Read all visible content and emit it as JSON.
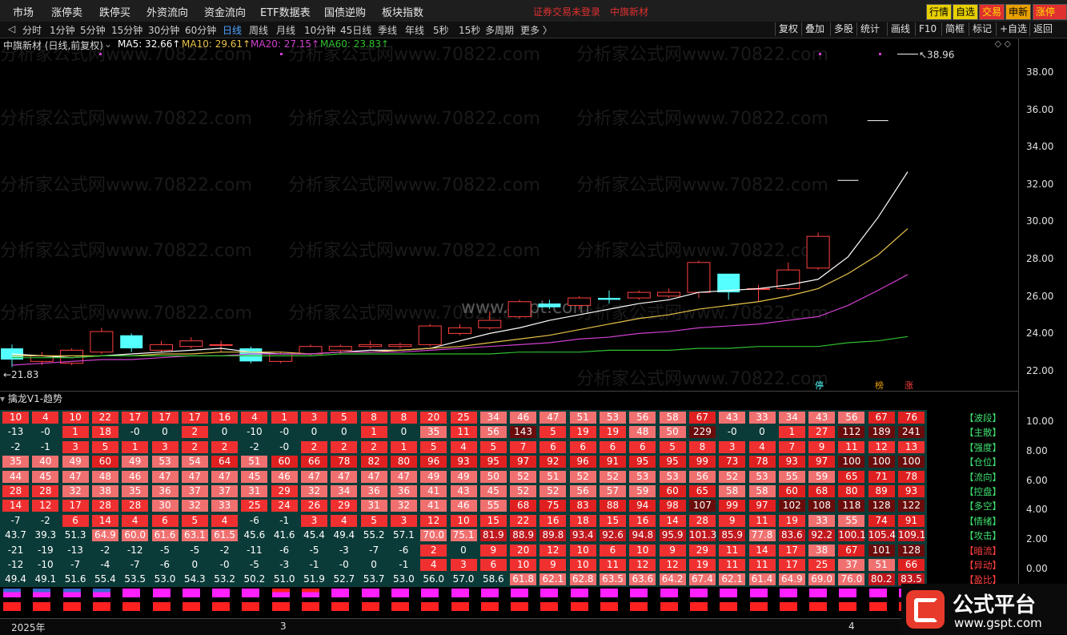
{
  "menu": [
    "市场",
    "涨停卖",
    "跌停买",
    "外资流向",
    "资金流向",
    "ETF数据表",
    "国债逆购",
    "板块指数"
  ],
  "status_text": "证券交易未登录　中旗新材",
  "right_buttons": [
    {
      "label": "行情",
      "bg": "#e8d000",
      "fg": "#000"
    },
    {
      "label": "自选",
      "bg": "#e8d000",
      "fg": "#000"
    },
    {
      "label": "交易",
      "bg": "#e03030",
      "fg": "#ffe000"
    },
    {
      "label": "申新",
      "bg": "#e8a000",
      "fg": "#000"
    },
    {
      "label": "涨停买",
      "bg": "#e03030",
      "fg": "#ffe000"
    }
  ],
  "periods": [
    "分时",
    "1分钟",
    "5分钟",
    "15分钟",
    "30分钟",
    "60分钟",
    "日线",
    "周线",
    "月线",
    "10分钟",
    "45日线",
    "季线",
    "年线",
    "5秒",
    "15秒",
    "多周期",
    "更多 〉"
  ],
  "active_period": "日线",
  "tools": [
    "复权",
    "叠加",
    "多股",
    "统计",
    "画线",
    "F10",
    "简框",
    "标记",
    "+自选",
    "返回"
  ],
  "stock_title": "中旗新材 (日线,前复权)",
  "ma": [
    {
      "label": "MA5: 32.66↑",
      "color": "#ffffff"
    },
    {
      "label": "MA10: 29.61↑",
      "color": "#e8c34a"
    },
    {
      "label": "MA20: 27.15↑",
      "color": "#d040d0"
    },
    {
      "label": "MA60: 23.83↑",
      "color": "#30c030"
    }
  ],
  "price_ticks": [
    "38.00",
    "36.00",
    "34.00",
    "32.00",
    "30.00",
    "28.00",
    "26.00",
    "24.00",
    "22.00"
  ],
  "high_label": "38.96",
  "low_label": "←21.83",
  "watermark": "分析家公式网www.70822.com",
  "center_watermark": "www.gspt.com",
  "markers": [
    "停",
    "榜",
    "涨"
  ],
  "indicator_title": "擒龙V1-趋势",
  "ind_ticks": [
    "10.00",
    "8.00",
    "6.00",
    "4.00",
    "2.00",
    "0.00"
  ],
  "rows": [
    {
      "tag": "【波段】",
      "tagRed": false,
      "v": [
        "10",
        "4",
        "10",
        "22",
        "17",
        "17",
        "17",
        "16",
        "4",
        "1",
        "3",
        "5",
        "8",
        "8",
        "20",
        "25",
        "34",
        "46",
        "47",
        "51",
        "53",
        "56",
        "58",
        "67",
        "43",
        "33",
        "34",
        "43",
        "56",
        "67",
        "76"
      ]
    },
    {
      "tag": "【主散】",
      "tagRed": false,
      "v": [
        "-13",
        "-0",
        "1",
        "18",
        "-0",
        "0",
        "2",
        "0",
        "-10",
        "-0",
        "0",
        "0",
        "1",
        "0",
        "35",
        "11",
        "56",
        "143",
        "5",
        "19",
        "19",
        "48",
        "50",
        "229",
        "-0",
        "0",
        "1",
        "27",
        "112",
        "189",
        "241"
      ]
    },
    {
      "tag": "【强度】",
      "tagRed": false,
      "v": [
        "-2",
        "-1",
        "3",
        "5",
        "1",
        "3",
        "2",
        "2",
        "-2",
        "-0",
        "2",
        "2",
        "2",
        "1",
        "5",
        "4",
        "5",
        "7",
        "6",
        "6",
        "6",
        "6",
        "5",
        "8",
        "3",
        "4",
        "7",
        "9",
        "11",
        "12",
        "13"
      ]
    },
    {
      "tag": "【仓位】",
      "tagRed": false,
      "v": [
        "35",
        "40",
        "49",
        "60",
        "49",
        "53",
        "54",
        "64",
        "51",
        "60",
        "66",
        "78",
        "82",
        "80",
        "96",
        "93",
        "95",
        "97",
        "92",
        "96",
        "91",
        "95",
        "95",
        "99",
        "73",
        "78",
        "93",
        "97",
        "100",
        "100",
        "100"
      ]
    },
    {
      "tag": "【流向】",
      "tagRed": false,
      "v": [
        "44",
        "45",
        "47",
        "48",
        "46",
        "47",
        "47",
        "47",
        "45",
        "46",
        "47",
        "47",
        "47",
        "47",
        "49",
        "49",
        "50",
        "52",
        "51",
        "52",
        "52",
        "53",
        "53",
        "56",
        "52",
        "53",
        "55",
        "59",
        "65",
        "71",
        "78"
      ]
    },
    {
      "tag": "【控盘】",
      "tagRed": false,
      "v": [
        "28",
        "28",
        "32",
        "38",
        "35",
        "36",
        "37",
        "37",
        "31",
        "29",
        "32",
        "34",
        "36",
        "36",
        "41",
        "43",
        "45",
        "52",
        "52",
        "56",
        "57",
        "59",
        "60",
        "65",
        "58",
        "58",
        "60",
        "68",
        "80",
        "89",
        "93"
      ]
    },
    {
      "tag": "【多空】",
      "tagRed": false,
      "v": [
        "14",
        "12",
        "17",
        "28",
        "28",
        "30",
        "32",
        "33",
        "25",
        "24",
        "26",
        "29",
        "31",
        "32",
        "41",
        "46",
        "55",
        "68",
        "75",
        "83",
        "88",
        "94",
        "98",
        "107",
        "99",
        "97",
        "102",
        "108",
        "118",
        "128",
        "122"
      ]
    },
    {
      "tag": "【情绪】",
      "tagRed": false,
      "v": [
        "-7",
        "-2",
        "6",
        "14",
        "4",
        "6",
        "5",
        "4",
        "-6",
        "-1",
        "3",
        "4",
        "5",
        "3",
        "12",
        "10",
        "15",
        "22",
        "16",
        "18",
        "15",
        "16",
        "14",
        "28",
        "9",
        "11",
        "19",
        "33",
        "55",
        "74",
        "91"
      ]
    },
    {
      "tag": "【攻击】",
      "tagRed": false,
      "v": [
        "43.7",
        "39.3",
        "51.3",
        "64.9",
        "60.0",
        "61.6",
        "63.1",
        "61.5",
        "45.6",
        "41.6",
        "45.4",
        "49.4",
        "55.2",
        "57.1",
        "70.0",
        "75.1",
        "81.9",
        "88.9",
        "89.8",
        "93.4",
        "92.6",
        "94.8",
        "95.9",
        "101.3",
        "85.9",
        "77.8",
        "83.6",
        "92.2",
        "100.1",
        "105.4",
        "109.1"
      ]
    },
    {
      "tag": "【暗流】",
      "tagRed": true,
      "v": [
        "-21",
        "-19",
        "-13",
        "-2",
        "-12",
        "-5",
        "-5",
        "-2",
        "-11",
        "-6",
        "-5",
        "-3",
        "-7",
        "-6",
        "2",
        "0",
        "9",
        "20",
        "12",
        "10",
        "6",
        "10",
        "9",
        "29",
        "11",
        "14",
        "17",
        "38",
        "67",
        "101",
        "128"
      ]
    },
    {
      "tag": "【异动】",
      "tagRed": true,
      "v": [
        "-12",
        "-10",
        "-7",
        "-4",
        "-7",
        "-6",
        "0",
        "-0",
        "-5",
        "-3",
        "-1",
        "-0",
        "0",
        "-1",
        "4",
        "3",
        "6",
        "10",
        "9",
        "10",
        "11",
        "12",
        "12",
        "19",
        "11",
        "11",
        "17",
        "25",
        "37",
        "51",
        "66"
      ]
    },
    {
      "tag": "【盈比】",
      "tagRed": true,
      "v": [
        "49.4",
        "49.1",
        "51.6",
        "55.4",
        "53.5",
        "53.0",
        "54.3",
        "53.2",
        "50.2",
        "51.0",
        "51.9",
        "52.7",
        "53.7",
        "53.0",
        "56.0",
        "57.0",
        "58.6",
        "61.8",
        "62.1",
        "62.8",
        "63.5",
        "63.6",
        "64.2",
        "67.4",
        "62.1",
        "61.4",
        "64.9",
        "69.0",
        "76.0",
        "80.2",
        "83.5"
      ]
    }
  ],
  "chart_data": {
    "type": "candlestick",
    "candles": [
      {
        "o": 23.2,
        "c": 22.6,
        "h": 23.4,
        "l": 22.2
      },
      {
        "o": 22.5,
        "c": 22.8,
        "h": 23.0,
        "l": 22.3
      },
      {
        "o": 22.4,
        "c": 23.1,
        "h": 23.2,
        "l": 22.3
      },
      {
        "o": 23.0,
        "c": 24.1,
        "h": 24.3,
        "l": 22.9
      },
      {
        "o": 23.9,
        "c": 23.2,
        "h": 24.0,
        "l": 23.0
      },
      {
        "o": 23.1,
        "c": 23.4,
        "h": 23.6,
        "l": 23.0
      },
      {
        "o": 23.3,
        "c": 23.6,
        "h": 23.8,
        "l": 23.2
      },
      {
        "o": 23.4,
        "c": 23.4,
        "h": 23.6,
        "l": 23.0
      },
      {
        "o": 23.2,
        "c": 22.5,
        "h": 23.3,
        "l": 22.4
      },
      {
        "o": 22.5,
        "c": 22.9,
        "h": 23.0,
        "l": 22.4
      },
      {
        "o": 22.9,
        "c": 23.3,
        "h": 23.4,
        "l": 22.8
      },
      {
        "o": 23.1,
        "c": 23.3,
        "h": 23.4,
        "l": 22.9
      },
      {
        "o": 23.3,
        "c": 23.4,
        "h": 23.6,
        "l": 23.2
      },
      {
        "o": 23.3,
        "c": 23.4,
        "h": 23.5,
        "l": 23.2
      },
      {
        "o": 23.4,
        "c": 24.4,
        "h": 24.5,
        "l": 23.3
      },
      {
        "o": 24.0,
        "c": 24.3,
        "h": 24.5,
        "l": 23.9
      },
      {
        "o": 24.3,
        "c": 24.7,
        "h": 25.2,
        "l": 24.2
      },
      {
        "o": 24.9,
        "c": 25.7,
        "h": 25.8,
        "l": 24.8
      },
      {
        "o": 25.6,
        "c": 25.4,
        "h": 25.8,
        "l": 25.3
      },
      {
        "o": 25.5,
        "c": 25.9,
        "h": 26.0,
        "l": 25.3
      },
      {
        "o": 25.9,
        "c": 25.8,
        "h": 26.3,
        "l": 25.6
      },
      {
        "o": 25.9,
        "c": 26.2,
        "h": 26.3,
        "l": 25.8
      },
      {
        "o": 26.0,
        "c": 26.2,
        "h": 26.4,
        "l": 25.9
      },
      {
        "o": 26.2,
        "c": 27.8,
        "h": 27.9,
        "l": 25.9
      },
      {
        "o": 27.2,
        "c": 26.2,
        "h": 27.2,
        "l": 25.8
      },
      {
        "o": 26.4,
        "c": 26.4,
        "h": 26.6,
        "l": 25.7
      },
      {
        "o": 26.4,
        "c": 27.4,
        "h": 27.8,
        "l": 26.3
      },
      {
        "o": 27.5,
        "c": 29.2,
        "h": 29.4,
        "l": 27.4
      },
      {
        "o": 32.2,
        "c": 32.2,
        "h": 32.2,
        "l": 32.2
      },
      {
        "o": 35.4,
        "c": 35.4,
        "h": 35.4,
        "l": 35.4
      },
      {
        "o": 38.96,
        "c": 38.96,
        "h": 38.96,
        "l": 38.96
      }
    ],
    "ma5": [
      22.9,
      22.8,
      22.7,
      22.8,
      22.9,
      23.0,
      23.1,
      23.2,
      23.0,
      22.9,
      22.9,
      23.0,
      23.1,
      23.1,
      23.2,
      23.6,
      24.0,
      24.3,
      24.7,
      25.0,
      25.3,
      25.6,
      25.8,
      26.2,
      26.3,
      26.4,
      26.6,
      26.9,
      28.1,
      30.2,
      32.66
    ],
    "ma10": [
      22.8,
      22.8,
      22.8,
      22.8,
      22.8,
      22.9,
      22.9,
      23.0,
      23.0,
      23.0,
      22.9,
      23.0,
      23.0,
      23.1,
      23.2,
      23.3,
      23.5,
      23.7,
      23.9,
      24.2,
      24.5,
      24.8,
      25.0,
      25.3,
      25.5,
      25.7,
      26.0,
      26.4,
      27.2,
      28.2,
      29.61
    ],
    "ma20": [
      22.3,
      22.4,
      22.5,
      22.6,
      22.6,
      22.7,
      22.8,
      22.8,
      22.9,
      22.9,
      22.9,
      23.0,
      23.0,
      23.0,
      23.1,
      23.2,
      23.3,
      23.4,
      23.5,
      23.7,
      23.8,
      24.0,
      24.1,
      24.3,
      24.4,
      24.5,
      24.7,
      24.9,
      25.5,
      26.3,
      27.15
    ],
    "ma60": [
      22.7,
      22.7,
      22.7,
      22.8,
      22.8,
      22.8,
      22.8,
      22.8,
      22.8,
      22.8,
      22.8,
      22.9,
      22.9,
      22.9,
      22.9,
      22.9,
      22.9,
      23.0,
      23.0,
      23.0,
      23.1,
      23.1,
      23.1,
      23.2,
      23.2,
      23.3,
      23.3,
      23.3,
      23.5,
      23.6,
      23.83
    ],
    "ylim": [
      21.5,
      39.5
    ]
  },
  "timebar": [
    "2025年",
    "3",
    "4"
  ]
}
